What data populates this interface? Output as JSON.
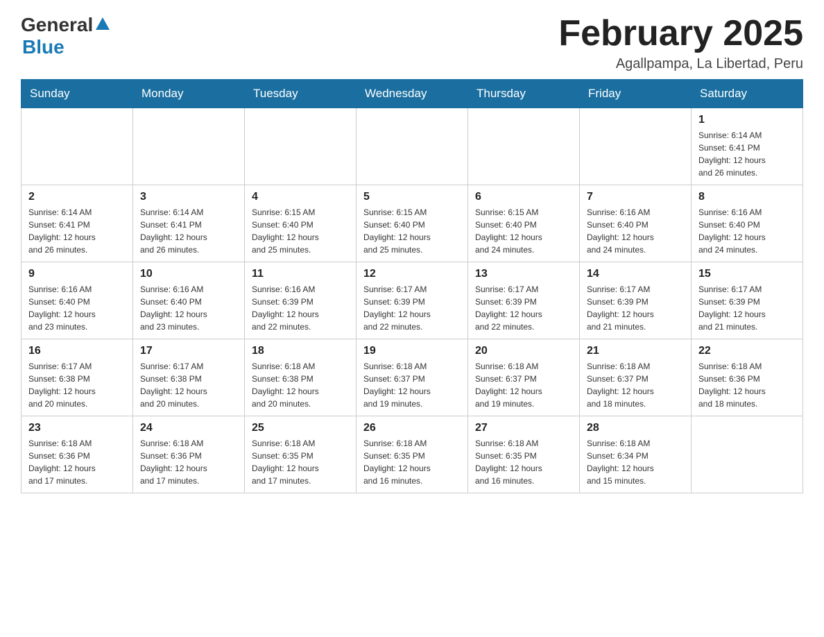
{
  "logo": {
    "general": "General",
    "blue": "Blue"
  },
  "header": {
    "title": "February 2025",
    "subtitle": "Agallpampa, La Libertad, Peru"
  },
  "days_of_week": [
    "Sunday",
    "Monday",
    "Tuesday",
    "Wednesday",
    "Thursday",
    "Friday",
    "Saturday"
  ],
  "weeks": [
    {
      "days": [
        {
          "number": "",
          "info": ""
        },
        {
          "number": "",
          "info": ""
        },
        {
          "number": "",
          "info": ""
        },
        {
          "number": "",
          "info": ""
        },
        {
          "number": "",
          "info": ""
        },
        {
          "number": "",
          "info": ""
        },
        {
          "number": "1",
          "info": "Sunrise: 6:14 AM\nSunset: 6:41 PM\nDaylight: 12 hours\nand 26 minutes."
        }
      ]
    },
    {
      "days": [
        {
          "number": "2",
          "info": "Sunrise: 6:14 AM\nSunset: 6:41 PM\nDaylight: 12 hours\nand 26 minutes."
        },
        {
          "number": "3",
          "info": "Sunrise: 6:14 AM\nSunset: 6:41 PM\nDaylight: 12 hours\nand 26 minutes."
        },
        {
          "number": "4",
          "info": "Sunrise: 6:15 AM\nSunset: 6:40 PM\nDaylight: 12 hours\nand 25 minutes."
        },
        {
          "number": "5",
          "info": "Sunrise: 6:15 AM\nSunset: 6:40 PM\nDaylight: 12 hours\nand 25 minutes."
        },
        {
          "number": "6",
          "info": "Sunrise: 6:15 AM\nSunset: 6:40 PM\nDaylight: 12 hours\nand 24 minutes."
        },
        {
          "number": "7",
          "info": "Sunrise: 6:16 AM\nSunset: 6:40 PM\nDaylight: 12 hours\nand 24 minutes."
        },
        {
          "number": "8",
          "info": "Sunrise: 6:16 AM\nSunset: 6:40 PM\nDaylight: 12 hours\nand 24 minutes."
        }
      ]
    },
    {
      "days": [
        {
          "number": "9",
          "info": "Sunrise: 6:16 AM\nSunset: 6:40 PM\nDaylight: 12 hours\nand 23 minutes."
        },
        {
          "number": "10",
          "info": "Sunrise: 6:16 AM\nSunset: 6:40 PM\nDaylight: 12 hours\nand 23 minutes."
        },
        {
          "number": "11",
          "info": "Sunrise: 6:16 AM\nSunset: 6:39 PM\nDaylight: 12 hours\nand 22 minutes."
        },
        {
          "number": "12",
          "info": "Sunrise: 6:17 AM\nSunset: 6:39 PM\nDaylight: 12 hours\nand 22 minutes."
        },
        {
          "number": "13",
          "info": "Sunrise: 6:17 AM\nSunset: 6:39 PM\nDaylight: 12 hours\nand 22 minutes."
        },
        {
          "number": "14",
          "info": "Sunrise: 6:17 AM\nSunset: 6:39 PM\nDaylight: 12 hours\nand 21 minutes."
        },
        {
          "number": "15",
          "info": "Sunrise: 6:17 AM\nSunset: 6:39 PM\nDaylight: 12 hours\nand 21 minutes."
        }
      ]
    },
    {
      "days": [
        {
          "number": "16",
          "info": "Sunrise: 6:17 AM\nSunset: 6:38 PM\nDaylight: 12 hours\nand 20 minutes."
        },
        {
          "number": "17",
          "info": "Sunrise: 6:17 AM\nSunset: 6:38 PM\nDaylight: 12 hours\nand 20 minutes."
        },
        {
          "number": "18",
          "info": "Sunrise: 6:18 AM\nSunset: 6:38 PM\nDaylight: 12 hours\nand 20 minutes."
        },
        {
          "number": "19",
          "info": "Sunrise: 6:18 AM\nSunset: 6:37 PM\nDaylight: 12 hours\nand 19 minutes."
        },
        {
          "number": "20",
          "info": "Sunrise: 6:18 AM\nSunset: 6:37 PM\nDaylight: 12 hours\nand 19 minutes."
        },
        {
          "number": "21",
          "info": "Sunrise: 6:18 AM\nSunset: 6:37 PM\nDaylight: 12 hours\nand 18 minutes."
        },
        {
          "number": "22",
          "info": "Sunrise: 6:18 AM\nSunset: 6:36 PM\nDaylight: 12 hours\nand 18 minutes."
        }
      ]
    },
    {
      "days": [
        {
          "number": "23",
          "info": "Sunrise: 6:18 AM\nSunset: 6:36 PM\nDaylight: 12 hours\nand 17 minutes."
        },
        {
          "number": "24",
          "info": "Sunrise: 6:18 AM\nSunset: 6:36 PM\nDaylight: 12 hours\nand 17 minutes."
        },
        {
          "number": "25",
          "info": "Sunrise: 6:18 AM\nSunset: 6:35 PM\nDaylight: 12 hours\nand 17 minutes."
        },
        {
          "number": "26",
          "info": "Sunrise: 6:18 AM\nSunset: 6:35 PM\nDaylight: 12 hours\nand 16 minutes."
        },
        {
          "number": "27",
          "info": "Sunrise: 6:18 AM\nSunset: 6:35 PM\nDaylight: 12 hours\nand 16 minutes."
        },
        {
          "number": "28",
          "info": "Sunrise: 6:18 AM\nSunset: 6:34 PM\nDaylight: 12 hours\nand 15 minutes."
        },
        {
          "number": "",
          "info": ""
        }
      ]
    }
  ]
}
